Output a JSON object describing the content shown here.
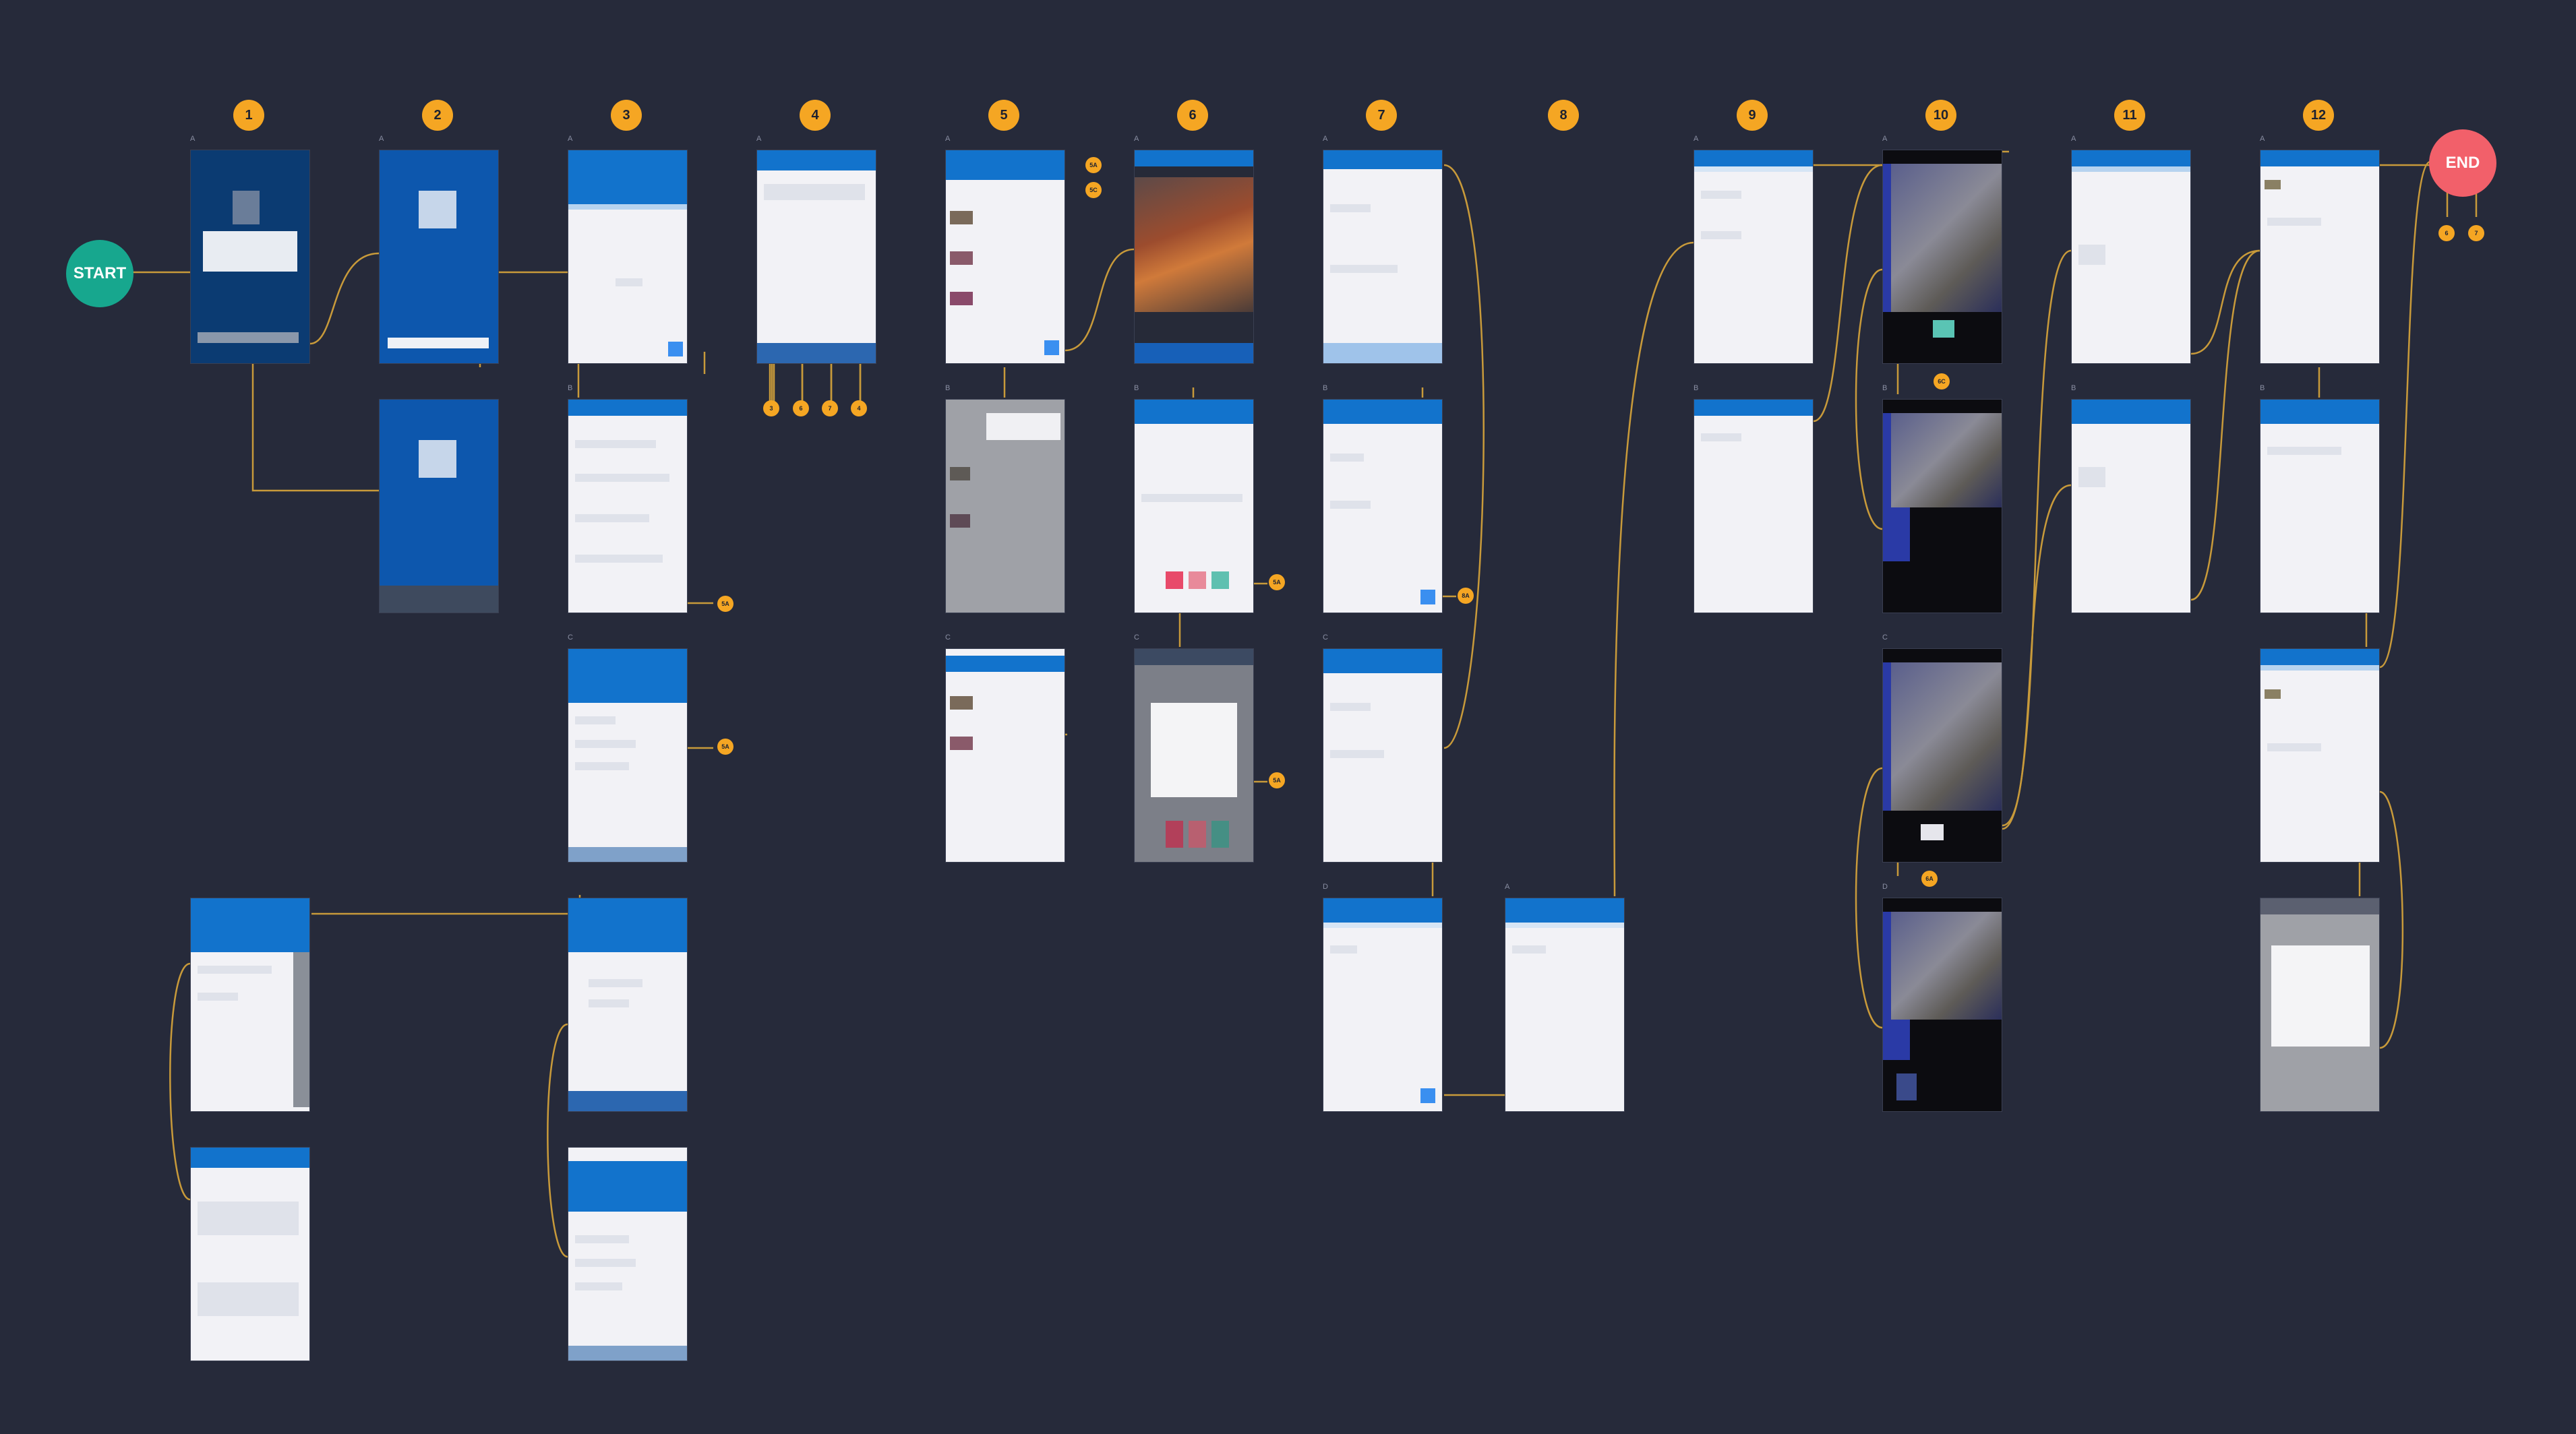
{
  "start_label": "START",
  "end_label": "END",
  "end_refs": [
    "6",
    "7"
  ],
  "columns": [
    "1",
    "2",
    "3",
    "4",
    "5",
    "6",
    "7",
    "8",
    "9",
    "10",
    "11",
    "12"
  ],
  "colors": {
    "background": "#262a3a",
    "accent": "#f5a623",
    "start": "#17a78e",
    "end": "#f2606a",
    "app_bar": "#1273cc",
    "connector": "#c89a3a"
  },
  "screen_labels": [
    "A",
    "B",
    "C",
    "D"
  ],
  "refs": {
    "s4_targets": [
      "3",
      "6",
      "7",
      "4"
    ],
    "s5a": [
      "5A",
      "5C"
    ],
    "s3b": "5A",
    "s3c": "5A",
    "s6b": "5A",
    "s6c": "5A",
    "s7b": "8A",
    "s10a": "6C",
    "s10c": "6A"
  }
}
